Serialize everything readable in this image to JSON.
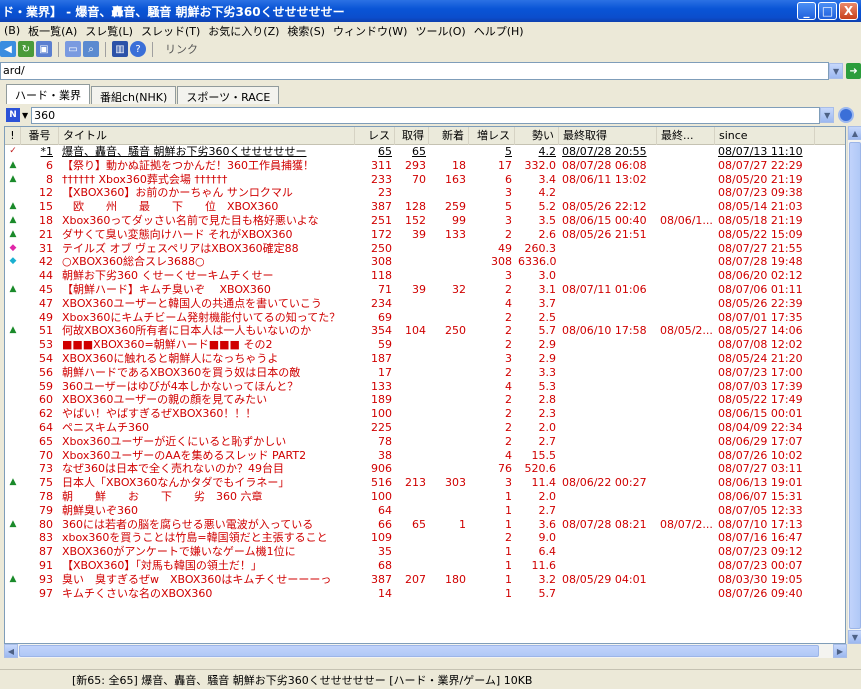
{
  "window": {
    "title": "ド・業界】 - 爆音、轟音、騒音 朝鮮お下劣360くせせせせせー",
    "buttons": [
      "_",
      "□",
      "X"
    ]
  },
  "menu": [
    "(B)",
    "板一覧(A)",
    "スレ覧(L)",
    "スレッド(T)",
    "お気に入り(Z)",
    "検索(S)",
    "ウィンドウ(W)",
    "ツール(O)",
    "ヘルプ(H)"
  ],
  "toolbar": {
    "link_label": "リンク"
  },
  "address": {
    "value": "ard/"
  },
  "tabs": [
    "ハード・業界",
    "番組ch(NHK)",
    "スポーツ・RACE"
  ],
  "search": {
    "value": "360"
  },
  "columns": [
    "!",
    "番号",
    "タイトル",
    "レス",
    "取得",
    "新着",
    "増レス",
    "勢い",
    "最終取得",
    "最終...",
    "since"
  ],
  "rows": [
    {
      "mark": "✓",
      "mt": "check",
      "num": "*1",
      "title": "爆音、轟音、騒音 朝鮮お下劣360くせせせせせー",
      "res": "65",
      "get": "65",
      "new": "",
      "inc": "5",
      "mom": "4.2",
      "last": "08/07/28 20:55",
      "last2": "",
      "since": "08/07/13 11:10",
      "read": true
    },
    {
      "mark": "▲",
      "mt": "up",
      "num": "6",
      "title": "【祭り】動かぬ証拠をつかんだ！360工作員捕獲！",
      "res": "311",
      "get": "293",
      "new": "18",
      "inc": "17",
      "mom": "332.0",
      "last": "08/07/28 06:08",
      "last2": "",
      "since": "08/07/27 22:29"
    },
    {
      "mark": "▲",
      "mt": "up",
      "num": "8",
      "title": "†††††† Xbox360葬式会場 ††††††",
      "res": "233",
      "get": "70",
      "new": "163",
      "inc": "6",
      "mom": "3.4",
      "last": "08/06/11 13:02",
      "last2": "",
      "since": "08/05/20 21:19"
    },
    {
      "mark": "",
      "mt": "",
      "num": "12",
      "title": "【XBOX360】お前のかーちゃん サンロクマル",
      "res": "23",
      "get": "",
      "new": "",
      "inc": "3",
      "mom": "4.2",
      "last": "",
      "last2": "",
      "since": "08/07/23 09:38"
    },
    {
      "mark": "▲",
      "mt": "up",
      "num": "15",
      "title": "　欧　　州　　最　　下　　位　XBOX360",
      "res": "387",
      "get": "128",
      "new": "259",
      "inc": "5",
      "mom": "5.2",
      "last": "08/05/26 22:12",
      "last2": "",
      "since": "08/05/14 21:03"
    },
    {
      "mark": "▲",
      "mt": "up",
      "num": "18",
      "title": "Xbox360ってダッさい名前で見た目も格好悪いよな",
      "res": "251",
      "get": "152",
      "new": "99",
      "inc": "3",
      "mom": "3.5",
      "last": "08/06/15 00:40",
      "last2": "08/06/1...",
      "since": "08/05/18 21:19"
    },
    {
      "mark": "▲",
      "mt": "up",
      "num": "21",
      "title": "ダサくて臭い変態向けハード それがXBOX360",
      "res": "172",
      "get": "39",
      "new": "133",
      "inc": "2",
      "mom": "2.6",
      "last": "08/05/26 21:51",
      "last2": "",
      "since": "08/05/22 15:09"
    },
    {
      "mark": "◆",
      "mt": "new",
      "num": "31",
      "title": "テイルズ オブ ヴェスペリアはXBOX360確定88",
      "res": "250",
      "get": "",
      "new": "",
      "inc": "49",
      "mom": "260.3",
      "last": "",
      "last2": "",
      "since": "08/07/27 21:55"
    },
    {
      "mark": "◆",
      "mt": "cyan",
      "num": "42",
      "title": "○XBOX360総合スレ3688○",
      "res": "308",
      "get": "",
      "new": "",
      "inc": "308",
      "mom": "6336.0",
      "last": "",
      "last2": "",
      "since": "08/07/28 19:48"
    },
    {
      "mark": "",
      "mt": "",
      "num": "44",
      "title": "朝鮮お下劣360 くせーくせーキムチくせー",
      "res": "118",
      "get": "",
      "new": "",
      "inc": "3",
      "mom": "3.0",
      "last": "",
      "last2": "",
      "since": "08/06/20 02:12"
    },
    {
      "mark": "▲",
      "mt": "up",
      "num": "45",
      "title": "【朝鮮ハード】キムチ臭いぞ　 XBOX360",
      "res": "71",
      "get": "39",
      "new": "32",
      "inc": "2",
      "mom": "3.1",
      "last": "08/07/11 01:06",
      "last2": "",
      "since": "08/07/06 01:11"
    },
    {
      "mark": "",
      "mt": "",
      "num": "47",
      "title": "XBOX360ユーザーと韓国人の共通点を書いていこう",
      "res": "234",
      "get": "",
      "new": "",
      "inc": "4",
      "mom": "3.7",
      "last": "",
      "last2": "",
      "since": "08/05/26 22:39"
    },
    {
      "mark": "",
      "mt": "",
      "num": "49",
      "title": "Xbox360にキムチビーム発射機能付いてるの知ってた？",
      "res": "69",
      "get": "",
      "new": "",
      "inc": "2",
      "mom": "2.5",
      "last": "",
      "last2": "",
      "since": "08/07/01 17:35"
    },
    {
      "mark": "▲",
      "mt": "up",
      "num": "51",
      "title": "何故XBOX360所有者に日本人は一人もいないのか",
      "res": "354",
      "get": "104",
      "new": "250",
      "inc": "2",
      "mom": "5.7",
      "last": "08/06/10 17:58",
      "last2": "08/05/2...",
      "since": "08/05/27 14:06"
    },
    {
      "mark": "",
      "mt": "",
      "num": "53",
      "title": "■■■XBOX360=朝鮮ハード■■■ その2",
      "res": "59",
      "get": "",
      "new": "",
      "inc": "2",
      "mom": "2.9",
      "last": "",
      "last2": "",
      "since": "08/07/08 12:02"
    },
    {
      "mark": "",
      "mt": "",
      "num": "54",
      "title": "XBOX360に触れると朝鮮人になっちゃうよ",
      "res": "187",
      "get": "",
      "new": "",
      "inc": "3",
      "mom": "2.9",
      "last": "",
      "last2": "",
      "since": "08/05/24 21:20"
    },
    {
      "mark": "",
      "mt": "",
      "num": "56",
      "title": "朝鮮ハードであるXBOX360を買う奴は日本の敵",
      "res": "17",
      "get": "",
      "new": "",
      "inc": "2",
      "mom": "3.3",
      "last": "",
      "last2": "",
      "since": "08/07/23 17:00"
    },
    {
      "mark": "",
      "mt": "",
      "num": "59",
      "title": "360ユーザーはゆびが4本しかないってほんと？",
      "res": "133",
      "get": "",
      "new": "",
      "inc": "4",
      "mom": "5.3",
      "last": "",
      "last2": "",
      "since": "08/07/03 17:39"
    },
    {
      "mark": "",
      "mt": "",
      "num": "60",
      "title": "XBOX360ユーザーの親の顔を見てみたい",
      "res": "189",
      "get": "",
      "new": "",
      "inc": "2",
      "mom": "2.8",
      "last": "",
      "last2": "",
      "since": "08/05/22 17:49"
    },
    {
      "mark": "",
      "mt": "",
      "num": "62",
      "title": "やばい！やばすぎるぜXBOX360！！！",
      "res": "100",
      "get": "",
      "new": "",
      "inc": "2",
      "mom": "2.3",
      "last": "",
      "last2": "",
      "since": "08/06/15 00:01"
    },
    {
      "mark": "",
      "mt": "",
      "num": "64",
      "title": "ペニスキムチ360",
      "res": "225",
      "get": "",
      "new": "",
      "inc": "2",
      "mom": "2.0",
      "last": "",
      "last2": "",
      "since": "08/04/09 22:34"
    },
    {
      "mark": "",
      "mt": "",
      "num": "65",
      "title": "Xbox360ユーザーが近くにいると恥ずかしい",
      "res": "78",
      "get": "",
      "new": "",
      "inc": "2",
      "mom": "2.7",
      "last": "",
      "last2": "",
      "since": "08/06/29 17:07"
    },
    {
      "mark": "",
      "mt": "",
      "num": "70",
      "title": "Xbox360ユーザーのAAを集めるスレッド PART2",
      "res": "38",
      "get": "",
      "new": "",
      "inc": "4",
      "mom": "15.5",
      "last": "",
      "last2": "",
      "since": "08/07/26 10:02"
    },
    {
      "mark": "",
      "mt": "",
      "num": "73",
      "title": "なぜ360は日本で全く売れないのか？49台目",
      "res": "906",
      "get": "",
      "new": "",
      "inc": "76",
      "mom": "520.6",
      "last": "",
      "last2": "",
      "since": "08/07/27 03:11"
    },
    {
      "mark": "▲",
      "mt": "up",
      "num": "75",
      "title": "日本人「XBOX360なんかタダでもイラネー」",
      "res": "516",
      "get": "213",
      "new": "303",
      "inc": "3",
      "mom": "11.4",
      "last": "08/06/22 00:27",
      "last2": "",
      "since": "08/06/13 19:01"
    },
    {
      "mark": "",
      "mt": "",
      "num": "78",
      "title": "朝　　鮮　　お　　下　　劣　360 六章",
      "res": "100",
      "get": "",
      "new": "",
      "inc": "1",
      "mom": "2.0",
      "last": "",
      "last2": "",
      "since": "08/06/07 15:31"
    },
    {
      "mark": "",
      "mt": "",
      "num": "79",
      "title": "朝鮮臭いぞ360",
      "res": "64",
      "get": "",
      "new": "",
      "inc": "1",
      "mom": "2.7",
      "last": "",
      "last2": "",
      "since": "08/07/05 12:33"
    },
    {
      "mark": "▲",
      "mt": "up",
      "num": "80",
      "title": "360には若者の脳を腐らせる悪い電波が入っている",
      "res": "66",
      "get": "65",
      "new": "1",
      "inc": "1",
      "mom": "3.6",
      "last": "08/07/28 08:21",
      "last2": "08/07/2...",
      "since": "08/07/10 17:13"
    },
    {
      "mark": "",
      "mt": "",
      "num": "83",
      "title": "xbox360を買うことは竹島=韓国領だと主張すること",
      "res": "109",
      "get": "",
      "new": "",
      "inc": "2",
      "mom": "9.0",
      "last": "",
      "last2": "",
      "since": "08/07/16 16:47"
    },
    {
      "mark": "",
      "mt": "",
      "num": "87",
      "title": "XBOX360がアンケートで嫌いなゲーム機1位に",
      "res": "35",
      "get": "",
      "new": "",
      "inc": "1",
      "mom": "6.4",
      "last": "",
      "last2": "",
      "since": "08/07/23 09:12"
    },
    {
      "mark": "",
      "mt": "",
      "num": "91",
      "title": "【XBOX360】「対馬も韓国の領土だ！」",
      "res": "68",
      "get": "",
      "new": "",
      "inc": "1",
      "mom": "11.6",
      "last": "",
      "last2": "",
      "since": "08/07/23 00:07"
    },
    {
      "mark": "▲",
      "mt": "up",
      "num": "93",
      "title": "臭い　臭すぎるぜw　XBOX360はキムチくせーーーっ",
      "res": "387",
      "get": "207",
      "new": "180",
      "inc": "1",
      "mom": "3.2",
      "last": "08/05/29 04:01",
      "last2": "",
      "since": "08/03/30 19:05"
    },
    {
      "mark": "",
      "mt": "",
      "num": "97",
      "title": "キムチくさいな名のXBOX360",
      "res": "14",
      "get": "",
      "new": "",
      "inc": "1",
      "mom": "5.7",
      "last": "",
      "last2": "",
      "since": "08/07/26 09:40"
    }
  ],
  "status": {
    "text": "[新65: 全65] 爆音、轟音、騒音 朝鮮お下劣360くせせせせせー [ハード・業界/ゲーム] 10KB"
  }
}
